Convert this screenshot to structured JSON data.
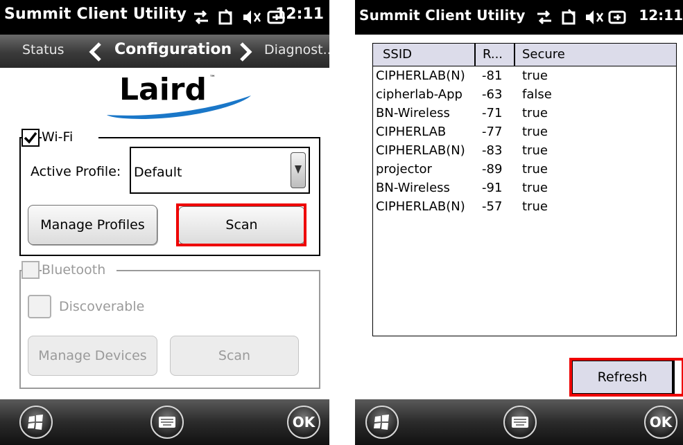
{
  "status_bar": {
    "title": "Summit Client Utility",
    "time": "12:11"
  },
  "tabs": {
    "prev": "Status",
    "current": "Configuration",
    "next": "Diagnost..."
  },
  "logo": {
    "text": "Laird",
    "tm": "™"
  },
  "wifi": {
    "label": "Wi-Fi",
    "checked": true,
    "active_profile_label": "Active Profile:",
    "active_profile_value": "Default",
    "manage_profiles_label": "Manage Profiles",
    "scan_label": "Scan"
  },
  "bluetooth": {
    "label": "Bluetooth",
    "discoverable_label": "Discoverable",
    "manage_devices_label": "Manage Devices",
    "scan_label": "Scan"
  },
  "scan_results": {
    "columns": [
      "SSID",
      "R...",
      "Secure"
    ],
    "rows": [
      [
        "CIPHERLAB(N)",
        "-81",
        "true"
      ],
      [
        "cipherlab-App",
        "-63",
        "false"
      ],
      [
        "BN-Wireless",
        "-71",
        "true"
      ],
      [
        "CIPHERLAB",
        "-77",
        "true"
      ],
      [
        "CIPHERLAB(N)",
        "-83",
        "true"
      ],
      [
        "projector",
        "-89",
        "true"
      ],
      [
        "BN-Wireless",
        "-91",
        "true"
      ],
      [
        "CIPHERLAB(N)",
        "-57",
        "true"
      ]
    ],
    "refresh_label": "Refresh"
  },
  "bottom_bar": {
    "start_icon": "windows-start-icon",
    "keyboard_icon": "keyboard-icon",
    "ok_label": "OK"
  },
  "colors": {
    "highlight": "#ee0000",
    "logo_blue": "#1a77c8",
    "header_bg": "#dcdcea"
  }
}
